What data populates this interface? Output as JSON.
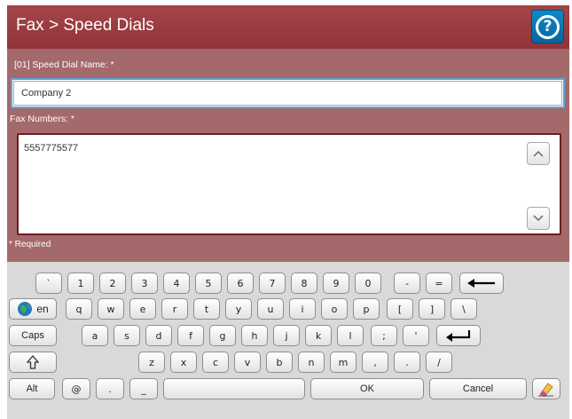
{
  "header": {
    "title": "Fax > Speed Dials",
    "help_icon": "help-icon",
    "help_glyph": "?"
  },
  "form": {
    "name_label": "[01] Speed Dial Name: *",
    "name_value": "Company 2",
    "numbers_label": "Fax Numbers: *",
    "numbers_value": "5557775577",
    "required_note": "* Required",
    "scroll_up_icon": "chevron-up-icon",
    "scroll_down_icon": "chevron-down-icon"
  },
  "keyboard": {
    "row1": [
      "`",
      "1",
      "2",
      "3",
      "4",
      "5",
      "6",
      "7",
      "8",
      "9",
      "0",
      "-",
      "="
    ],
    "backspace_icon": "backspace-arrow-icon",
    "language_label": "en",
    "globe_icon": "globe-icon",
    "row2": [
      "q",
      "w",
      "e",
      "r",
      "t",
      "y",
      "u",
      "i",
      "o",
      "p",
      "[",
      "]",
      "\\"
    ],
    "caps_label": "Caps",
    "row3": [
      "a",
      "s",
      "d",
      "f",
      "g",
      "h",
      "j",
      "k",
      "l",
      ";",
      "'"
    ],
    "enter_icon": "enter-icon",
    "shift_icon": "shift-icon",
    "row4": [
      "z",
      "x",
      "c",
      "v",
      "b",
      "n",
      "m",
      ",",
      ".",
      "/"
    ],
    "alt_label": "Alt",
    "at_label": "@",
    "period_label": ".",
    "underscore_label": "_",
    "ok_label": "OK",
    "cancel_label": "Cancel",
    "clear_icon": "eraser-icon"
  },
  "colors": {
    "titlebar": "#9c3c41",
    "form_bg": "#a4696b",
    "accent_blue": "#5aa4dc",
    "keyboard_bg": "#d9d9d9"
  }
}
